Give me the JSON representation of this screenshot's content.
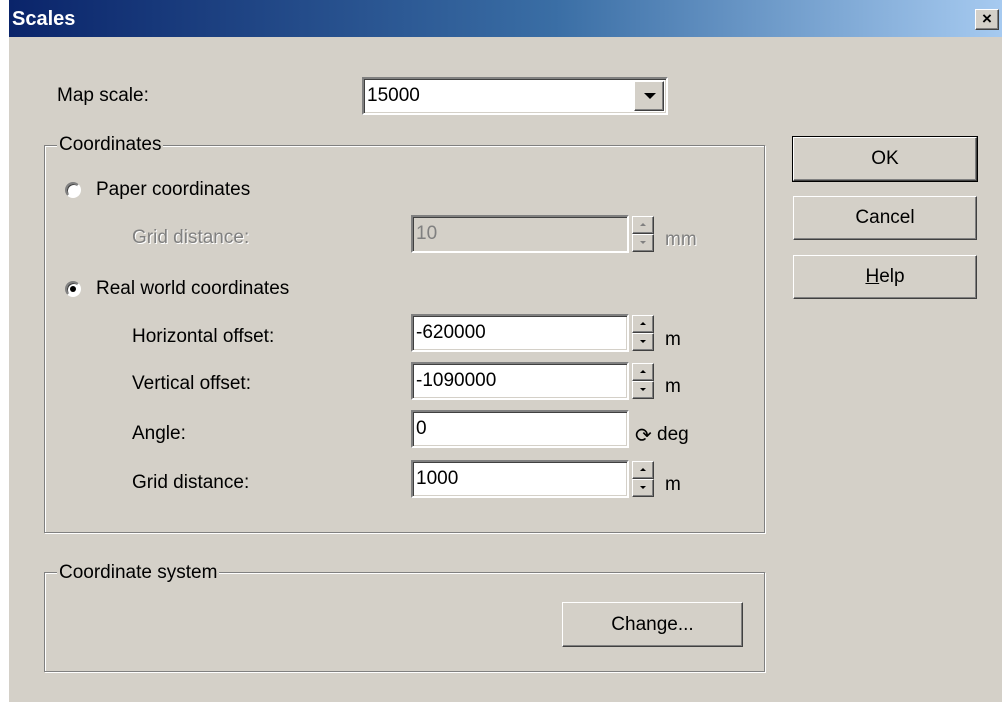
{
  "window": {
    "title": "Scales",
    "close_glyph": "×"
  },
  "map_scale": {
    "label": "Map scale:",
    "value": "15000",
    "icon": "chevron-down-icon"
  },
  "coordinates": {
    "group_label": "Coordinates",
    "paper": {
      "label": "Paper coordinates",
      "selected": false,
      "grid_distance": {
        "label": "Grid distance:",
        "value": "10",
        "unit": "mm",
        "enabled": false
      }
    },
    "real_world": {
      "label": "Real world coordinates",
      "selected": true,
      "horizontal_offset": {
        "label": "Horizontal offset:",
        "value": "-620000",
        "unit": "m"
      },
      "vertical_offset": {
        "label": "Vertical offset:",
        "value": "-1090000",
        "unit": "m"
      },
      "angle": {
        "label": "Angle:",
        "value": "0",
        "unit": "deg",
        "icon_glyph": "⟳",
        "icon": "rotate-icon"
      },
      "grid_distance": {
        "label": "Grid distance:",
        "value": "1000",
        "unit": "m"
      }
    }
  },
  "coordinate_system": {
    "group_label": "Coordinate system",
    "change_label": "Change..."
  },
  "buttons": {
    "ok": "OK",
    "cancel": "Cancel",
    "help_mnemonic": "H",
    "help_rest": "elp"
  }
}
